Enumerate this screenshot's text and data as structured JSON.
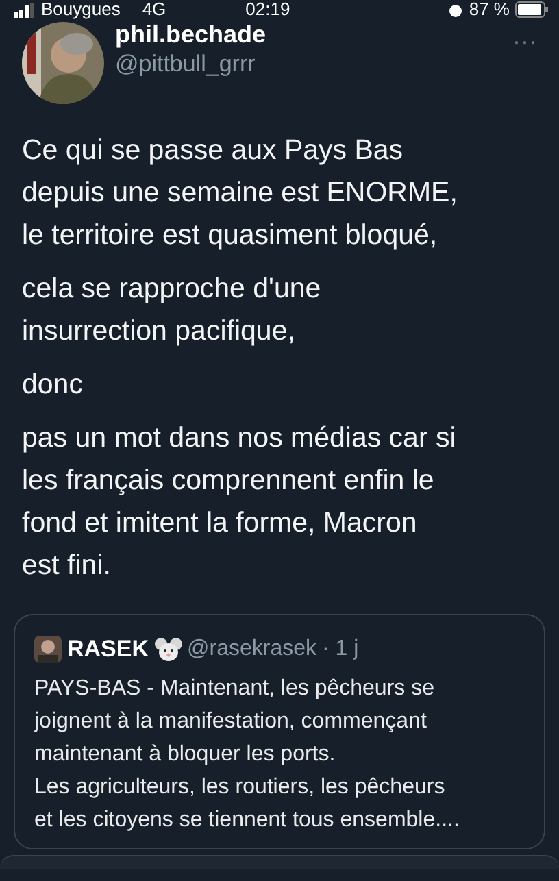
{
  "status_bar": {
    "carrier": "Bouygues",
    "network": "4G",
    "time": "02:19",
    "battery": "87 %"
  },
  "tweet": {
    "name": "phil.bechade",
    "handle": "@pittbull_grrr",
    "more": "···",
    "paragraphs": [
      [
        "Ce qui se passe aux Pays Bas",
        "depuis une semaine est ENORME,",
        "le territoire est quasiment bloqué,"
      ],
      [
        "cela se rapproche d'une",
        "insurrection pacifique,"
      ],
      [
        "donc"
      ],
      [
        "pas un mot dans nos médias car si",
        "les français comprennent enfin le",
        "fond et imitent la forme, Macron",
        "est fini."
      ]
    ]
  },
  "quote": {
    "name": "RASEK",
    "handle": "@rasekrasek",
    "time": "· 1 j",
    "lines": [
      "PAYS-BAS - Maintenant, les pêcheurs se",
      "joignent à la manifestation, commençant",
      "maintenant à bloquer les ports.",
      "Les agriculteurs, les routiers, les pêcheurs",
      "et les citoyens se tiennent tous ensemble...."
    ]
  }
}
